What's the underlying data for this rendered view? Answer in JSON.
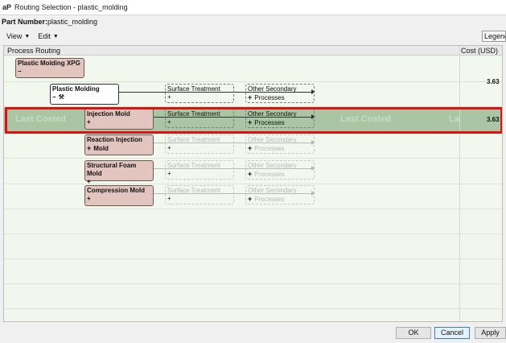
{
  "window": {
    "logo": "aP",
    "title": "Routing Selection - plastic_molding"
  },
  "part": {
    "label": "Part Number:",
    "value": "plastic_molding"
  },
  "toolbar": {
    "view_label": "View",
    "edit_label": "Edit",
    "legend_label": "Legend"
  },
  "grid": {
    "headers": {
      "routing": "Process Routing",
      "cost": "Cost (USD)"
    },
    "watermark": {
      "left": "Last Costed",
      "right": "Last Costed",
      "far_right": "La"
    },
    "costs": {
      "plastic_molding": "3.63",
      "injection_mold": "3.63"
    }
  },
  "nodes": {
    "root": {
      "label": "Plastic Molding XPG",
      "toggle": "−"
    },
    "plastic_molding": {
      "label": "Plastic Molding",
      "toggle": "−"
    },
    "injection_mold": {
      "label": "Injection Mold",
      "toggle": "+"
    },
    "reaction_injection": {
      "label": "Reaction Injection",
      "label2": "Mold",
      "toggle": "+"
    },
    "structural_foam": {
      "label": "Structural Foam Mold",
      "toggle": "+"
    },
    "compression": {
      "label": "Compression Mold",
      "toggle": "+"
    }
  },
  "steps": {
    "surface": "Surface Treatment",
    "other": "Other Secondary",
    "processes": "Processes",
    "plus": "+"
  },
  "buttons": {
    "ok": "OK",
    "cancel": "Cancel",
    "apply": "Apply"
  },
  "colors": {
    "selection_border": "#e01010",
    "node_fill": "#e2c5bf",
    "selected_row": "#a9c5a4"
  }
}
